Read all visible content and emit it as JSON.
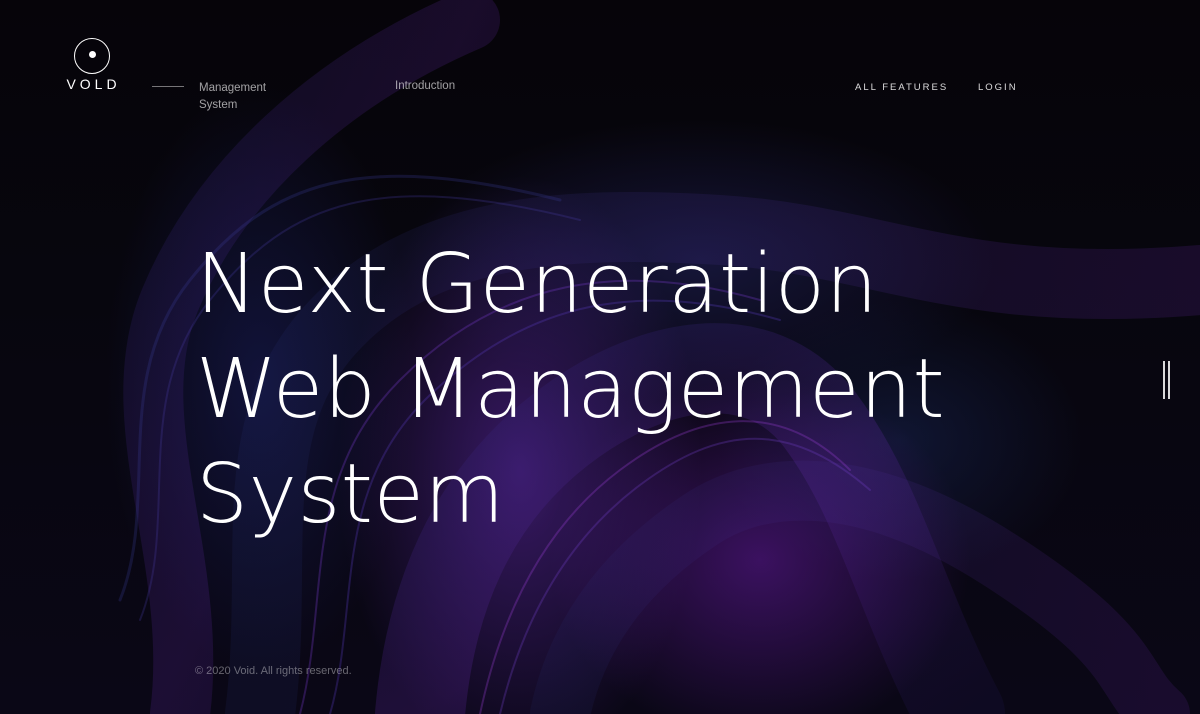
{
  "brand": {
    "name": "VOLD"
  },
  "nav": {
    "subtitle_line1": "Management",
    "subtitle_line2": "System",
    "intro_label": "Introduction",
    "all_features_label": "ALL FEATURES",
    "login_label": "LOGIN"
  },
  "hero": {
    "line1": "Next Generation",
    "line2": "Web Management",
    "line3": "System"
  },
  "footer": {
    "copyright": "© 2020 Void. All rights reserved."
  },
  "colors": {
    "background": "#050409",
    "accent_purple": "#6a2ab0",
    "accent_blue": "#22276e",
    "text": "#ffffff"
  },
  "icons": {
    "logo": "circle-dot-icon",
    "slider": "double-bar-icon"
  }
}
